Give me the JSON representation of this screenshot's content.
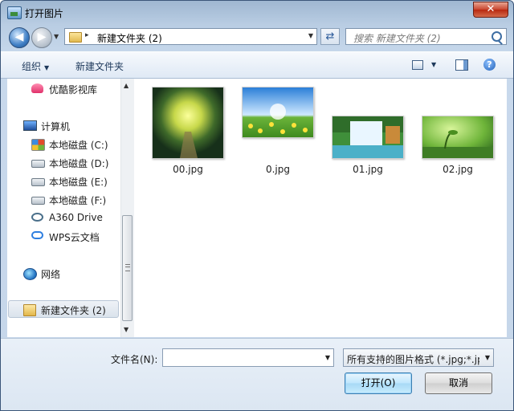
{
  "window": {
    "title": "打开图片",
    "close_glyph": "✕"
  },
  "navigation": {
    "back_glyph": "◀",
    "forward_glyph": "▶",
    "breadcrumb": "新建文件夹 (2)",
    "breadcrumb_separator": "▸",
    "refresh_glyph": "⇄",
    "search_placeholder": "搜索 新建文件夹 (2)"
  },
  "toolbar": {
    "organize_label": "组织",
    "new_folder_label": "新建文件夹",
    "help_glyph": "?"
  },
  "sidebar": {
    "items": [
      {
        "label": "优酷影视库",
        "icon": "youku-icon"
      },
      {
        "label": "计算机",
        "icon": "computer-icon"
      },
      {
        "label": "本地磁盘 (C:)",
        "icon": "windows-drive-icon"
      },
      {
        "label": "本地磁盘 (D:)",
        "icon": "drive-icon"
      },
      {
        "label": "本地磁盘 (E:)",
        "icon": "drive-icon"
      },
      {
        "label": "本地磁盘 (F:)",
        "icon": "drive-icon"
      },
      {
        "label": "A360 Drive",
        "icon": "a360-icon"
      },
      {
        "label": "WPS云文档",
        "icon": "cloud-icon"
      },
      {
        "label": "网络",
        "icon": "network-icon"
      },
      {
        "label": "新建文件夹 (2)",
        "icon": "folder-icon",
        "selected": true
      }
    ]
  },
  "files": [
    {
      "name": "00.jpg",
      "subject": "forest tunnel"
    },
    {
      "name": "0.jpg",
      "subject": "dandelion field"
    },
    {
      "name": "01.jpg",
      "subject": "waterfall"
    },
    {
      "name": "02.jpg",
      "subject": "sprout"
    }
  ],
  "bottom": {
    "filename_label": "文件名(N):",
    "filename_value": "",
    "filetype_value": "所有支持的图片格式 (*.jpg;*.jp",
    "open_label": "打开(O)",
    "cancel_label": "取消"
  },
  "colors": {
    "selection_bg": "#dbe3ec",
    "window_frame": "#c8d9ec",
    "close_red": "#c9452e"
  }
}
